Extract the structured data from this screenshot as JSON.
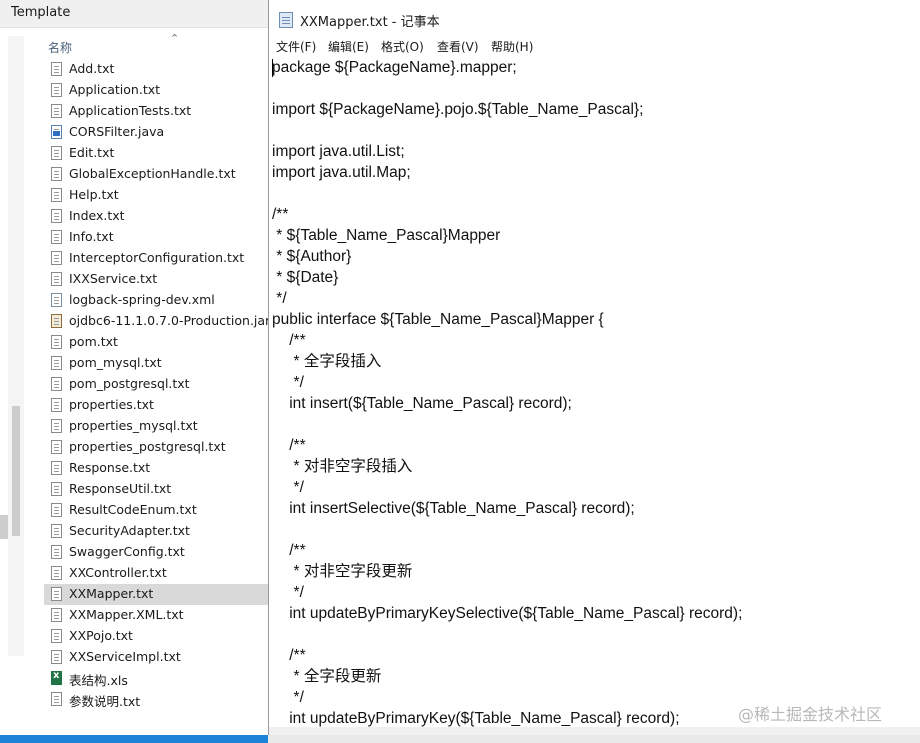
{
  "explorer": {
    "title": "Template",
    "column_name": "名称",
    "files": [
      {
        "name": "Add.txt",
        "icon": "text-file-icon"
      },
      {
        "name": "Application.txt",
        "icon": "text-file-icon"
      },
      {
        "name": "ApplicationTests.txt",
        "icon": "text-file-icon"
      },
      {
        "name": "CORSFilter.java",
        "icon": "java-file-icon"
      },
      {
        "name": "Edit.txt",
        "icon": "text-file-icon"
      },
      {
        "name": "GlobalExceptionHandle.txt",
        "icon": "text-file-icon"
      },
      {
        "name": "Help.txt",
        "icon": "text-file-icon"
      },
      {
        "name": "Index.txt",
        "icon": "text-file-icon"
      },
      {
        "name": "Info.txt",
        "icon": "text-file-icon"
      },
      {
        "name": "InterceptorConfiguration.txt",
        "icon": "text-file-icon"
      },
      {
        "name": "IXXService.txt",
        "icon": "text-file-icon"
      },
      {
        "name": "logback-spring-dev.xml",
        "icon": "xml-file-icon"
      },
      {
        "name": "ojdbc6-11.1.0.7.0-Production.jar",
        "icon": "jar-file-icon"
      },
      {
        "name": "pom.txt",
        "icon": "text-file-icon"
      },
      {
        "name": "pom_mysql.txt",
        "icon": "text-file-icon"
      },
      {
        "name": "pom_postgresql.txt",
        "icon": "text-file-icon"
      },
      {
        "name": "properties.txt",
        "icon": "text-file-icon"
      },
      {
        "name": "properties_mysql.txt",
        "icon": "text-file-icon"
      },
      {
        "name": "properties_postgresql.txt",
        "icon": "text-file-icon"
      },
      {
        "name": "Response.txt",
        "icon": "text-file-icon"
      },
      {
        "name": "ResponseUtil.txt",
        "icon": "text-file-icon"
      },
      {
        "name": "ResultCodeEnum.txt",
        "icon": "text-file-icon"
      },
      {
        "name": "SecurityAdapter.txt",
        "icon": "text-file-icon"
      },
      {
        "name": "SwaggerConfig.txt",
        "icon": "text-file-icon"
      },
      {
        "name": "XXController.txt",
        "icon": "text-file-icon"
      },
      {
        "name": "XXMapper.txt",
        "icon": "text-file-icon",
        "selected": true
      },
      {
        "name": "XXMapper.XML.txt",
        "icon": "text-file-icon"
      },
      {
        "name": "XXPojo.txt",
        "icon": "text-file-icon"
      },
      {
        "name": "XXServiceImpl.txt",
        "icon": "text-file-icon"
      },
      {
        "name": "表结构.xls",
        "icon": "excel-file-icon"
      },
      {
        "name": "参数说明.txt",
        "icon": "text-file-icon"
      }
    ]
  },
  "notepad": {
    "title": "XXMapper.txt - 记事本",
    "menu": [
      "文件(F)",
      "编辑(E)",
      "格式(O)",
      "查看(V)",
      "帮助(H)"
    ],
    "lines": [
      "package ${PackageName}.mapper;",
      "",
      "import ${PackageName}.pojo.${Table_Name_Pascal};",
      "",
      "import java.util.List;",
      "import java.util.Map;",
      "",
      "/**",
      " * ${Table_Name_Pascal}Mapper",
      " * ${Author}",
      " * ${Date}",
      " */",
      "public interface ${Table_Name_Pascal}Mapper {",
      "    /**",
      "     * 全字段插入",
      "     */",
      "    int insert(${Table_Name_Pascal} record);",
      "",
      "    /**",
      "     * 对非空字段插入",
      "     */",
      "    int insertSelective(${Table_Name_Pascal} record);",
      "",
      "    /**",
      "     * 对非空字段更新",
      "     */",
      "    int updateByPrimaryKeySelective(${Table_Name_Pascal} record);",
      "",
      "    /**",
      "     * 全字段更新",
      "     */",
      "    int updateByPrimaryKey(${Table_Name_Pascal} record);"
    ]
  },
  "watermark": "@稀土掘金技术社区",
  "colors": {
    "selection": "#d9d9d9",
    "taskbar": "#1b84d8",
    "header_text": "#4c607a"
  }
}
